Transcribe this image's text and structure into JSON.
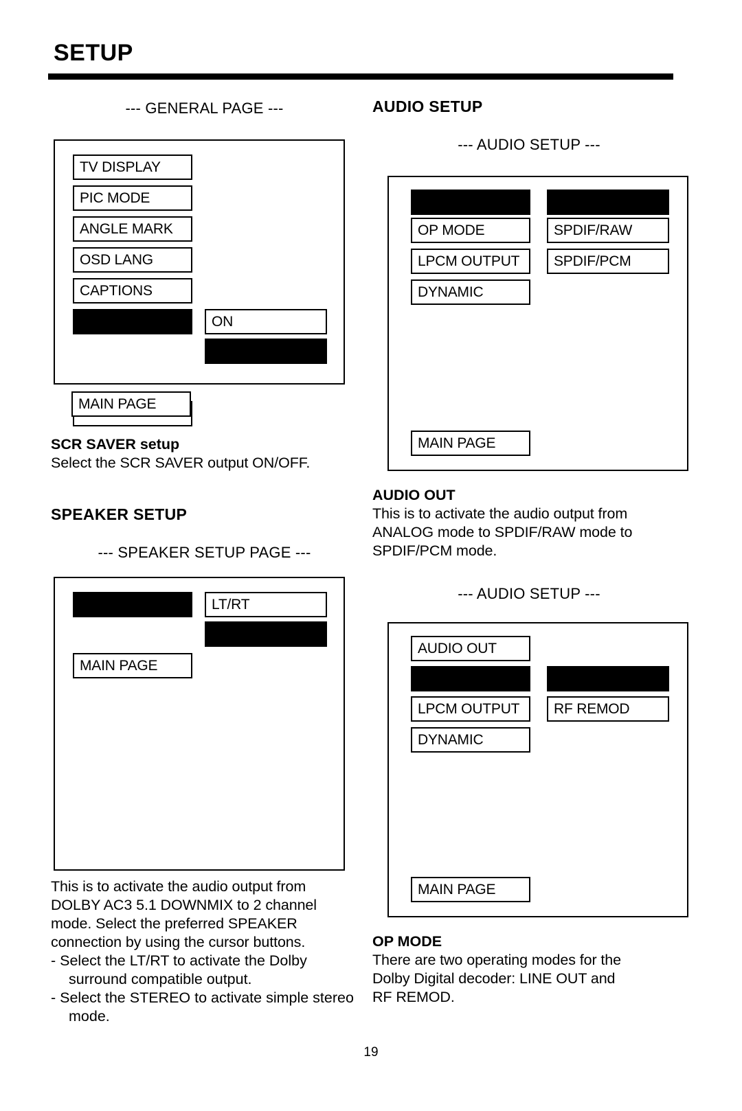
{
  "document": {
    "title": "SETUP",
    "page_number": "19"
  },
  "left_column": {
    "general": {
      "screen_caption": "--- GENERAL PAGE ---",
      "menu_items": [
        {
          "label": "TV DISPLAY",
          "blank": false
        },
        {
          "label": "PIC MODE",
          "blank": false
        },
        {
          "label": "ANGLE MARK",
          "blank": false
        },
        {
          "label": "OSD LANG",
          "blank": false
        },
        {
          "label": "CAPTIONS",
          "blank": false
        },
        {
          "label": "",
          "blank": true
        }
      ],
      "value_items": [
        {
          "label": "ON",
          "blank": false
        },
        {
          "label": "",
          "blank": true
        }
      ],
      "main_page_label": "MAIN PAGE"
    },
    "scr_saver": {
      "heading": "SCR SAVER setup",
      "body": "Select the SCR SAVER output ON/OFF."
    },
    "speaker": {
      "heading": "SPEAKER SETUP",
      "screen_caption": "--- SPEAKER SETUP PAGE ---",
      "menu_items": [
        {
          "label": "",
          "blank": true
        }
      ],
      "value_items": [
        {
          "label": "LT/RT",
          "blank": false
        },
        {
          "label": "",
          "blank": true
        }
      ],
      "main_page_label": "MAIN PAGE",
      "body_lines": [
        "This is to activate the audio output from",
        "DOLBY AC3 5.1 DOWNMIX to 2 channel",
        "mode.  Select the preferred SPEAKER",
        "connection by using the cursor buttons."
      ],
      "bullets": [
        "-  Select the LT/RT to activate the Dolby surround compatible output.",
        "-  Select the STEREO to activate simple stereo mode."
      ]
    }
  },
  "right_column": {
    "audio_setup": {
      "heading": "AUDIO SETUP",
      "screen_caption": "--- AUDIO SETUP ---",
      "menu_items": [
        {
          "label": "",
          "blank": true
        },
        {
          "label": "OP MODE",
          "blank": false
        },
        {
          "label": "LPCM OUTPUT",
          "blank": false
        },
        {
          "label": "DYNAMIC",
          "blank": false
        }
      ],
      "value_items": [
        {
          "label": "",
          "blank": true
        },
        {
          "label": "SPDIF/RAW",
          "blank": false
        },
        {
          "label": "SPDIF/PCM",
          "blank": false
        }
      ],
      "main_page_label": "MAIN PAGE"
    },
    "audio_out": {
      "heading": "AUDIO OUT",
      "body_lines": [
        "This is to activate the audio output from",
        "ANALOG mode to SPDIF/RAW mode to",
        "SPDIF/PCM mode."
      ]
    },
    "audio_setup_2": {
      "screen_caption": "--- AUDIO SETUP ---",
      "menu_items": [
        {
          "label": "AUDIO OUT",
          "blank": false
        },
        {
          "label": "",
          "blank": true
        },
        {
          "label": "LPCM OUTPUT",
          "blank": false
        },
        {
          "label": "DYNAMIC",
          "blank": false
        }
      ],
      "value_items": [
        {
          "label": "",
          "blank": true
        },
        {
          "label": "RF REMOD",
          "blank": false
        }
      ],
      "main_page_label": "MAIN PAGE"
    },
    "op_mode": {
      "heading": "OP MODE",
      "body_lines": [
        "There are two operating modes for the",
        "Dolby Digital decoder:  LINE OUT and",
        "RF REMOD."
      ]
    }
  }
}
